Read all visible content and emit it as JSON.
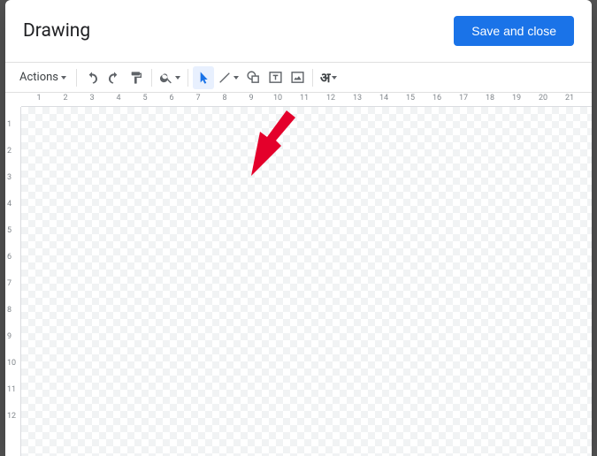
{
  "header": {
    "title": "Drawing",
    "save_label": "Save and close"
  },
  "toolbar": {
    "actions_label": "Actions",
    "language_glyph": "अ"
  },
  "ruler": {
    "h": [
      "1",
      "1",
      "2",
      "3",
      "4",
      "5",
      "6",
      "7",
      "8",
      "9",
      "10",
      "11",
      "12",
      "13",
      "14",
      "15",
      "16",
      "17",
      "18",
      "19",
      "20",
      "21"
    ],
    "v": [
      "1",
      "1",
      "2",
      "3",
      "4",
      "5",
      "6",
      "7",
      "8",
      "9",
      "10",
      "11",
      "12"
    ]
  }
}
